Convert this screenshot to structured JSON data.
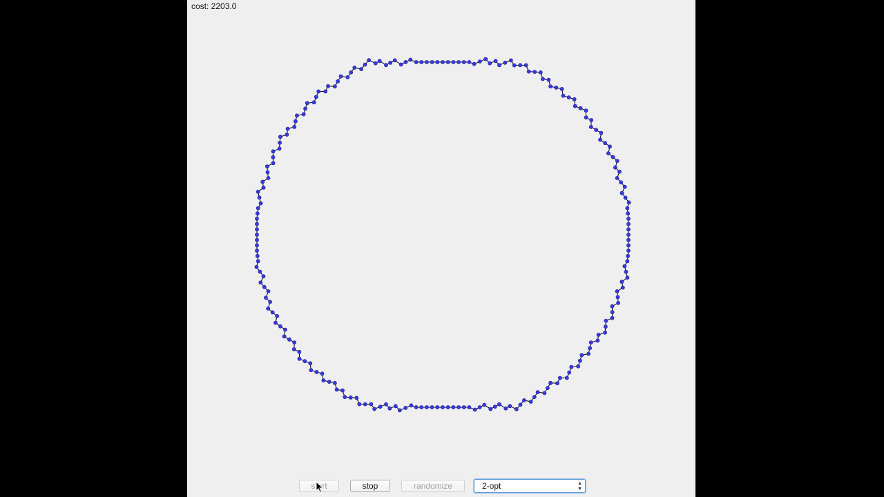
{
  "status": {
    "cost_label": "cost: 2203.0"
  },
  "controls": {
    "start_label": "start",
    "stop_label": "stop",
    "randomize_label": "randomize",
    "algorithm_selected": "2-opt",
    "start_enabled": false,
    "stop_enabled": true,
    "randomize_enabled": false
  },
  "colors": {
    "window_background": "#efeff0",
    "outer_background": "#000000",
    "city_fill": "#3a3adb",
    "city_stroke": "#1c1c9c",
    "tour_line": "#000000",
    "select_focus": "#5b9bd5"
  },
  "icons": {
    "select_indicator": "up-down-arrows-icon",
    "cursor": "mouse-pointer-icon"
  }
}
